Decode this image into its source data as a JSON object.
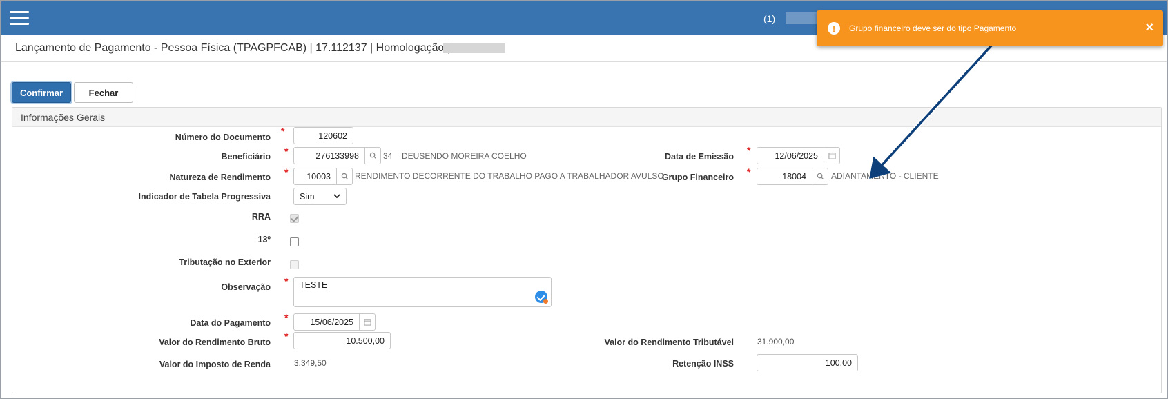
{
  "topbar": {
    "menu_icon": "hamburger-menu-icon",
    "notification_count": "(1)",
    "brand_color": "#3a74b0"
  },
  "header": {
    "title": "Lançamento de Pagamento - Pessoa Física (TPAGPFCAB) | 17.112137 | Homologação | S"
  },
  "toolbar": {
    "confirm_label": "Confirmar",
    "close_label": "Fechar"
  },
  "panel": {
    "title": "Informações Gerais"
  },
  "form": {
    "numero_documento": {
      "label": "Número do Documento",
      "value": "120602",
      "required": true
    },
    "beneficiario": {
      "label": "Beneficiário",
      "value": "276133998",
      "code": "34",
      "description": "DEUSENDO MOREIRA COELHO",
      "required": true
    },
    "natureza_rendimento": {
      "label": "Natureza de Rendimento",
      "value": "10003",
      "description": "RENDIMENTO DECORRENTE DO TRABALHO PAGO A TRABALHADOR AVULSO",
      "required": true
    },
    "indicador_tabela": {
      "label": "Indicador de Tabela Progressiva",
      "value": "Sim"
    },
    "rra": {
      "label": "RRA",
      "checked": true,
      "disabled": true
    },
    "decimo_terceiro": {
      "label": "13º",
      "checked": false
    },
    "tributacao_exterior": {
      "label": "Tributação no Exterior",
      "checked": false,
      "disabled": true
    },
    "observacao": {
      "label": "Observação",
      "value": "TESTE",
      "required": true
    },
    "data_pagamento": {
      "label": "Data do Pagamento",
      "value": "15/06/2025",
      "required": true
    },
    "valor_rendimento_bruto": {
      "label": "Valor do Rendimento Bruto",
      "value": "10.500,00",
      "required": true
    },
    "valor_imposto_renda": {
      "label": "Valor do Imposto de Renda",
      "value": "3.349,50"
    },
    "data_emissao": {
      "label": "Data de Emissão",
      "value": "12/06/2025",
      "required": true
    },
    "grupo_financeiro": {
      "label": "Grupo Financeiro",
      "value": "18004",
      "description": "ADIANTAMENTO - CLIENTE",
      "required": true
    },
    "valor_rendimento_tributavel": {
      "label": "Valor do Rendimento Tributável",
      "value": "31.900,00"
    },
    "retencao_inss": {
      "label": "Retenção INSS",
      "value": "100,00"
    }
  },
  "toast": {
    "message": "Grupo financeiro deve ser do tipo Pagamento",
    "icon": "exclamation-icon",
    "close": "×",
    "color": "#f7941d"
  },
  "annotation": {
    "arrow_color": "#0d3f7a"
  }
}
